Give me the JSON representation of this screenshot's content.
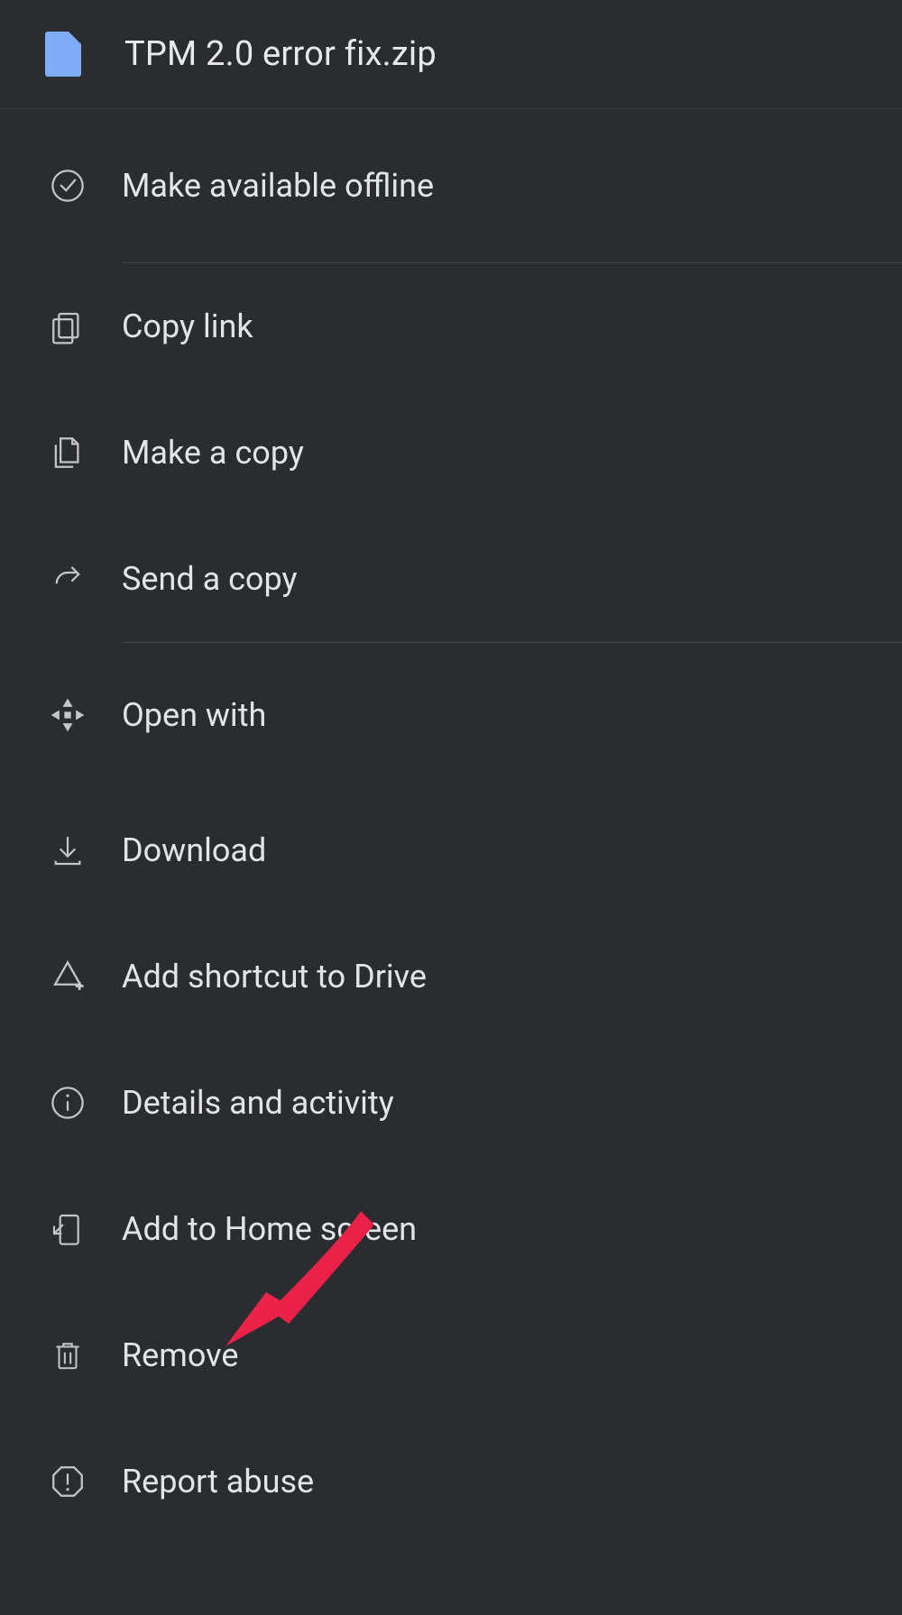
{
  "file": {
    "name": "TPM 2.0 error fix.zip"
  },
  "menu": {
    "make_available_offline": "Make available offline",
    "copy_link": "Copy link",
    "make_a_copy": "Make a copy",
    "send_a_copy": "Send a copy",
    "open_with": "Open with",
    "download": "Download",
    "add_shortcut_to_drive": "Add shortcut to Drive",
    "details_and_activity": "Details and activity",
    "add_to_home_screen": "Add to Home screen",
    "remove": "Remove",
    "report_abuse": "Report abuse"
  },
  "annotation": {
    "arrow_color": "#f5274f",
    "target": "remove"
  }
}
